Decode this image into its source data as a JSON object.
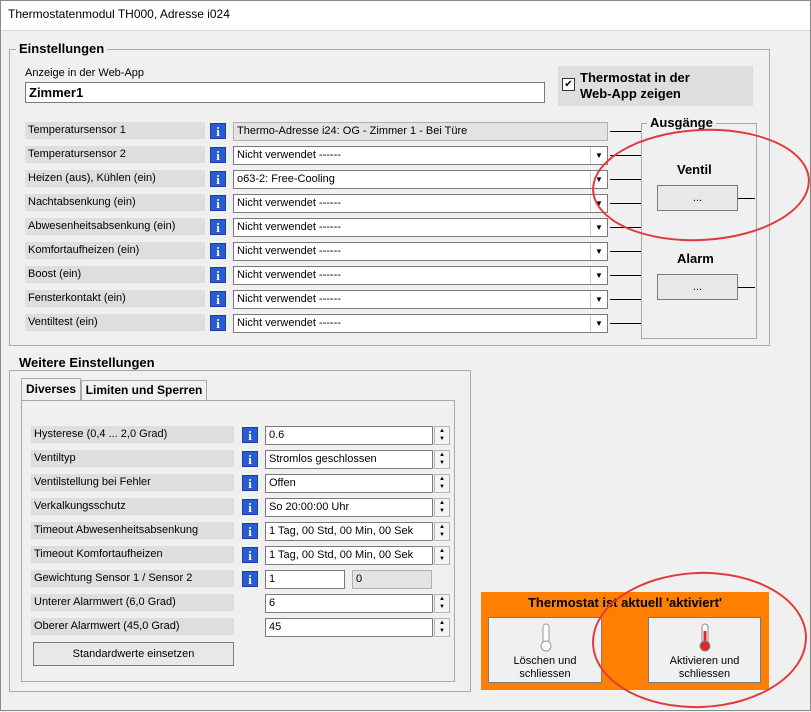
{
  "window": {
    "title": "Thermostatenmodul TH000, Adresse i024"
  },
  "einstellungen": {
    "title": "Einstellungen",
    "webapp_label": "Anzeige in der Web-App",
    "webapp_value": "Zimmer1",
    "show_checkbox_label_1": "Thermostat in der",
    "show_checkbox_label_2": "Web-App zeigen",
    "show_checkbox_checked": "✔",
    "rows": [
      {
        "label": "Temperatursensor 1",
        "value": "Thermo-Adresse i24: OG - Zimmer 1 - Bei Türe"
      },
      {
        "label": "Temperatursensor 2",
        "value": "Nicht verwendet ------"
      },
      {
        "label": "Heizen (aus), Kühlen (ein)",
        "value": "o63-2: Free-Cooling"
      },
      {
        "label": "Nachtabsenkung (ein)",
        "value": "Nicht verwendet ------"
      },
      {
        "label": "Abwesenheitsabsenkung (ein)",
        "value": "Nicht verwendet ------"
      },
      {
        "label": "Komfortaufheizen (ein)",
        "value": "Nicht verwendet ------"
      },
      {
        "label": "Boost (ein)",
        "value": "Nicht verwendet ------"
      },
      {
        "label": "Fensterkontakt (ein)",
        "value": "Nicht verwendet ------"
      },
      {
        "label": "Ventiltest (ein)",
        "value": "Nicht verwendet ------"
      }
    ],
    "ausgaenge": {
      "title": "Ausgänge",
      "ventil_label": "Ventil",
      "ventil_button": "...",
      "alarm_label": "Alarm",
      "alarm_button": "..."
    }
  },
  "weitere": {
    "title": "Weitere Einstellungen",
    "tabs": [
      "Diverses",
      "Limiten und Sperren"
    ],
    "rows": [
      {
        "label": "Hysterese (0,4 ... 2,0 Grad)",
        "value": "0.6"
      },
      {
        "label": "Ventiltyp",
        "value": "Stromlos geschlossen"
      },
      {
        "label": "Ventilstellung bei Fehler",
        "value": "Offen"
      },
      {
        "label": "Verkalkungsschutz",
        "value": "So 20:00:00 Uhr"
      },
      {
        "label": "Timeout Abwesenheitsabsenkung",
        "value": "1 Tag, 00 Std, 00 Min, 00 Sek"
      },
      {
        "label": "Timeout Komfortaufheizen",
        "value": "1 Tag, 00 Std, 00 Min, 00 Sek"
      }
    ],
    "gewichtung": {
      "label": "Gewichtung Sensor 1 / Sensor 2",
      "value1": "1",
      "value2": "0"
    },
    "unterer": {
      "label": "Unterer Alarmwert (6,0 Grad)",
      "value": "6"
    },
    "oberer": {
      "label": "Oberer Alarmwert (45,0 Grad)",
      "value": "45"
    },
    "default_button": "Standardwerte einsetzen"
  },
  "status": {
    "title": "Thermostat ist aktuell 'aktiviert'",
    "delete_button_1": "Löschen und",
    "delete_button_2": "schliessen",
    "activate_button_1": "Aktivieren und",
    "activate_button_2": "schliessen",
    "panel_color": "#ff8000"
  },
  "icons": {
    "info": "i",
    "arrow": "▼",
    "spin_up": "▲",
    "spin_down": "▼"
  }
}
